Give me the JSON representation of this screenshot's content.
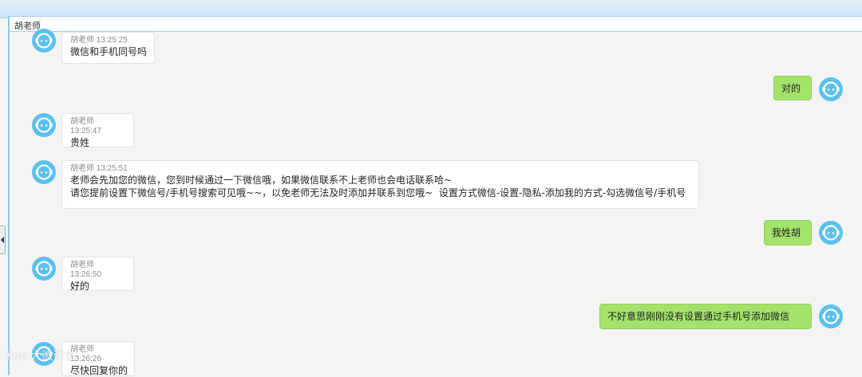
{
  "window": {
    "title": "胡老师"
  },
  "contact_avatar_icon": "customer-service-icon",
  "messages": [
    {
      "dir": "in",
      "sender": "胡老师",
      "time": "13:25:25",
      "text": "微信和手机同号吗"
    },
    {
      "dir": "out",
      "text": "对的"
    },
    {
      "dir": "in",
      "sender": "胡老师",
      "time": "13:25:47",
      "text": "贵姓"
    },
    {
      "dir": "in",
      "sender": "胡老师",
      "time": "13:25:51",
      "text": "老师会先加您的微信，您到时候通过一下微信哦，如果微信联系不上老师也会电话联系哈~\n请您提前设置下微信号/手机号搜索可见哦~~，以免老师无法及时添加并联系到您哦~  设置方式微信-设置-隐私-添加我的方式-勾选微信号/手机号"
    },
    {
      "dir": "out",
      "text": "我姓胡"
    },
    {
      "dir": "in",
      "sender": "胡老师",
      "time": "13:26:50",
      "text": "好的"
    },
    {
      "dir": "out",
      "text": "不好意思刚刚没有设置通过手机号添加微信"
    },
    {
      "dir": "in",
      "sender": "胡老师",
      "time": "13:26:26",
      "text": "尽快回复你的"
    }
  ],
  "watermark": "Kuo 大微课堂",
  "colors": {
    "incoming_bubble": "#ffffff",
    "outgoing_bubble": "#a3e26b",
    "avatar": "#5cc0ee",
    "frame_border": "#8ec7ea"
  }
}
